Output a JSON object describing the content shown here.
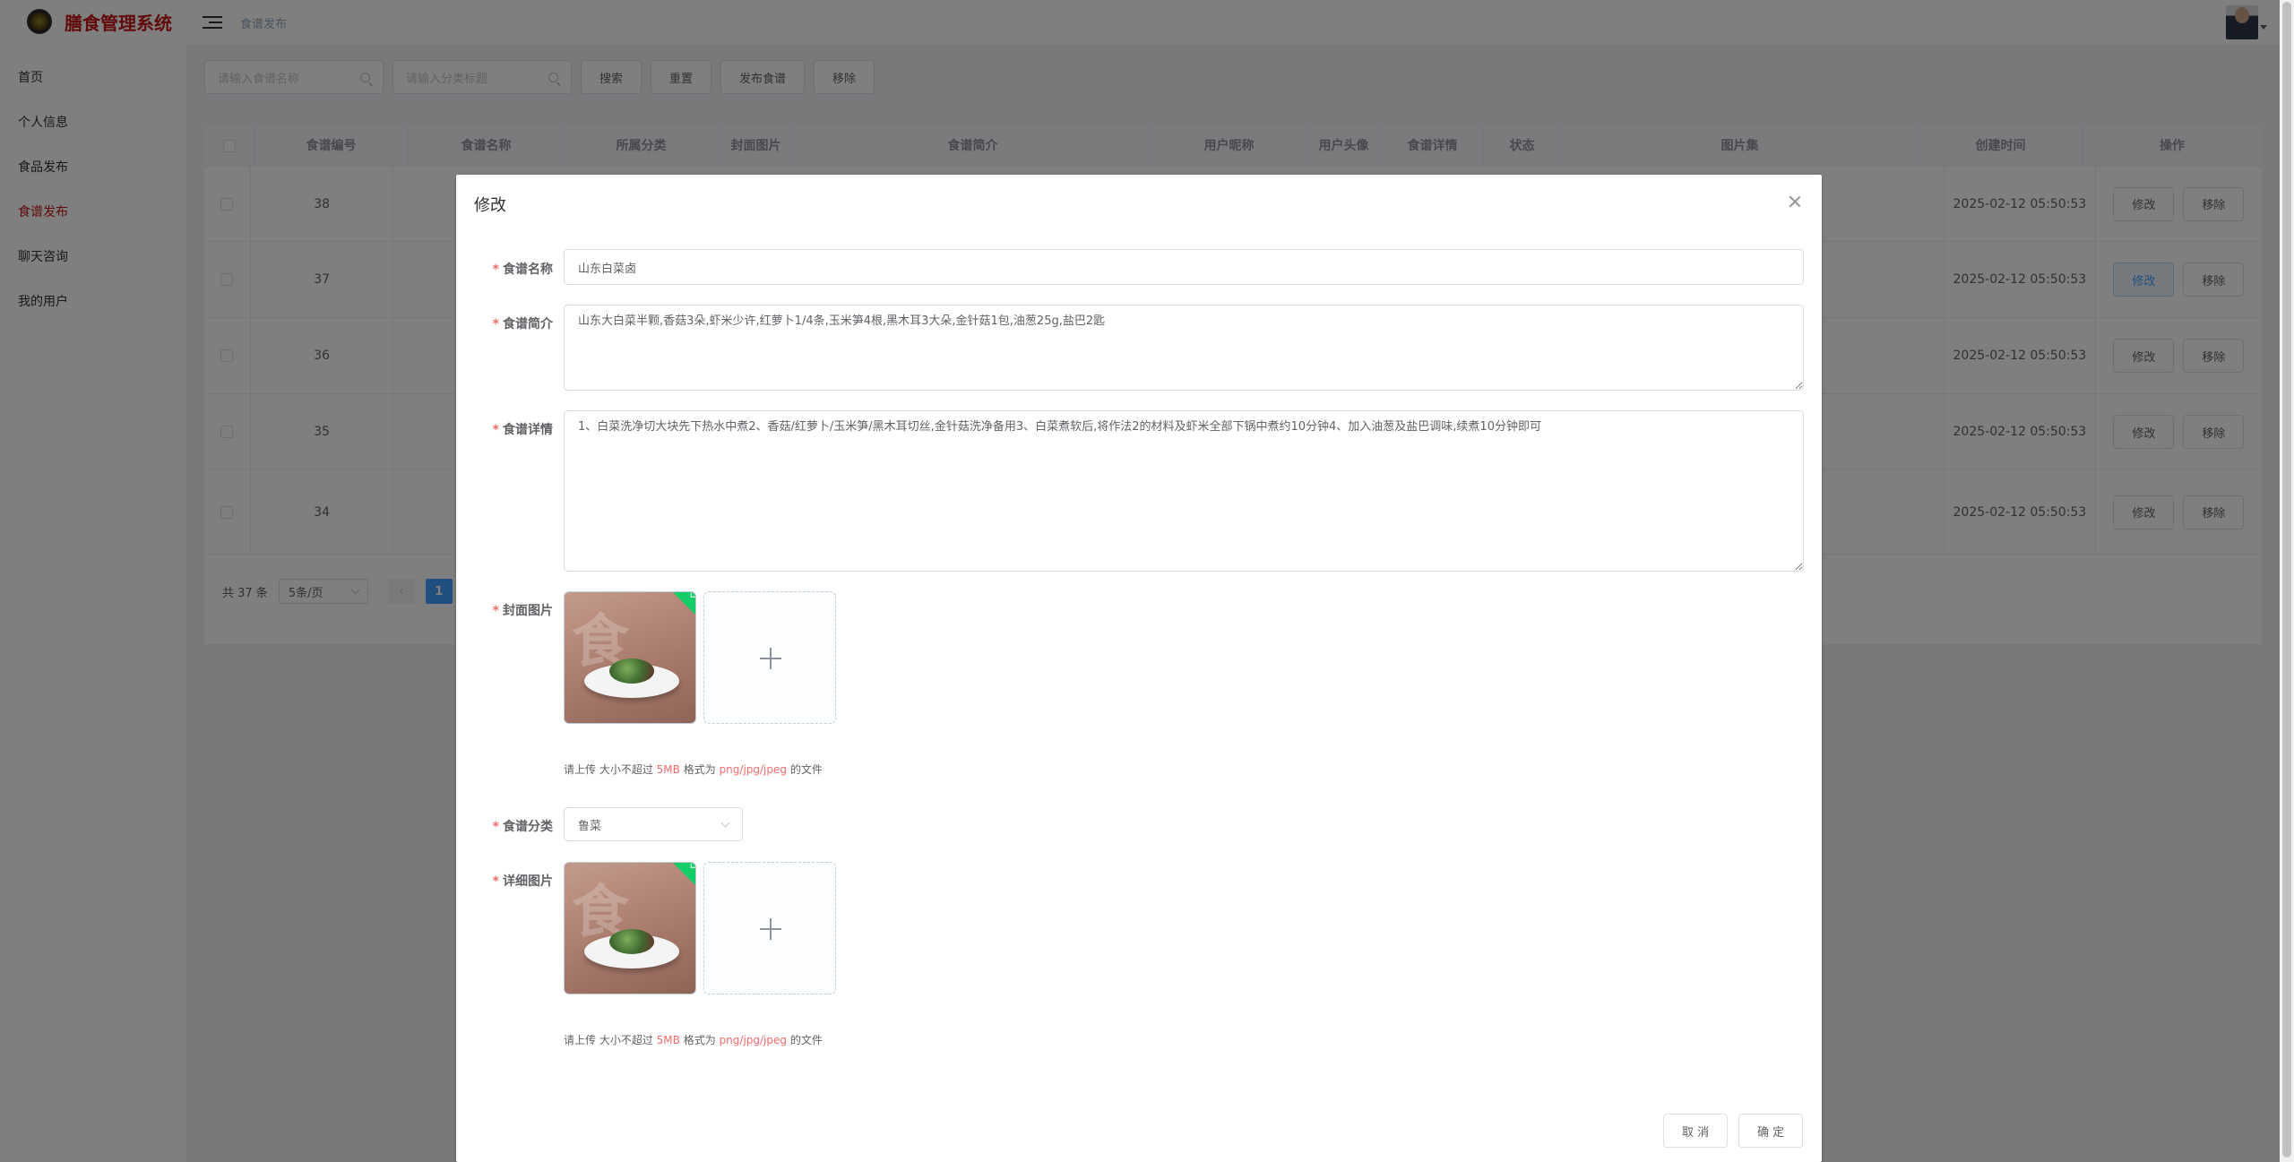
{
  "app": {
    "title": "膳食管理系统"
  },
  "sidebar": {
    "items": [
      {
        "label": "首页"
      },
      {
        "label": "个人信息"
      },
      {
        "label": "食品发布"
      },
      {
        "label": "食谱发布"
      },
      {
        "label": "聊天咨询"
      },
      {
        "label": "我的用户"
      }
    ],
    "active_index": 3
  },
  "header": {
    "breadcrumb": "食谱发布"
  },
  "toolbar": {
    "search_name_placeholder": "请输入食谱名称",
    "search_category_placeholder": "请输入分类标题",
    "search_label": "搜索",
    "reset_label": "重置",
    "publish_label": "发布食谱",
    "remove_label": "移除"
  },
  "table": {
    "columns": [
      "食谱编号",
      "食谱名称",
      "所属分类",
      "封面图片",
      "食谱简介",
      "用户昵称",
      "用户头像",
      "食谱详情",
      "状态",
      "图片集",
      "创建时间",
      "操作"
    ],
    "rows": [
      {
        "id": "38",
        "created": "2025-02-12 05:50:53"
      },
      {
        "id": "37",
        "created": "2025-02-12 05:50:53"
      },
      {
        "id": "36",
        "created": "2025-02-12 05:50:53"
      },
      {
        "id": "35",
        "created": "2025-02-12 05:50:53"
      },
      {
        "id": "34",
        "created": "2025-02-12 05:50:53"
      }
    ],
    "edit_label": "修改",
    "remove_label": "移除"
  },
  "pagination": {
    "total": "共 37 条",
    "page_size": "5条/页",
    "prev": "‹",
    "current_page": "1"
  },
  "dialog": {
    "title": "修改",
    "fields": {
      "name": {
        "label": "食谱名称",
        "value": "山东白菜卤"
      },
      "intro": {
        "label": "食谱简介",
        "value": "山东大白菜半颗,香菇3朵,虾米少许,红萝卜1/4条,玉米笋4根,黑木耳3大朵,金针菇1包,油葱25g,盐巴2匙"
      },
      "detail": {
        "label": "食谱详情",
        "value": "1、白菜洗净切大块先下热水中煮2、香菇/红萝卜/玉米笋/黑木耳切丝,金针菇洗净备用3、白菜煮软后,将作法2的材料及虾米全部下锅中煮约10分钟4、加入油葱及盐巴调味,续煮10分钟即可"
      },
      "cover": {
        "label": "封面图片"
      },
      "category": {
        "label": "食谱分类",
        "value": "鲁菜"
      },
      "images": {
        "label": "详细图片"
      }
    },
    "upload_tip": {
      "prefix": "请上传 大小不超过",
      "size": "5MB",
      "middle": "格式为",
      "formats": "png/jpg/jpeg",
      "suffix": "的文件"
    },
    "thumb_char": "食",
    "cancel_label": "取 消",
    "confirm_label": "确 定"
  },
  "colors": {
    "brand": "#c51515",
    "primary": "#409eff",
    "success": "#13ce66",
    "required": "#f56c6c"
  }
}
